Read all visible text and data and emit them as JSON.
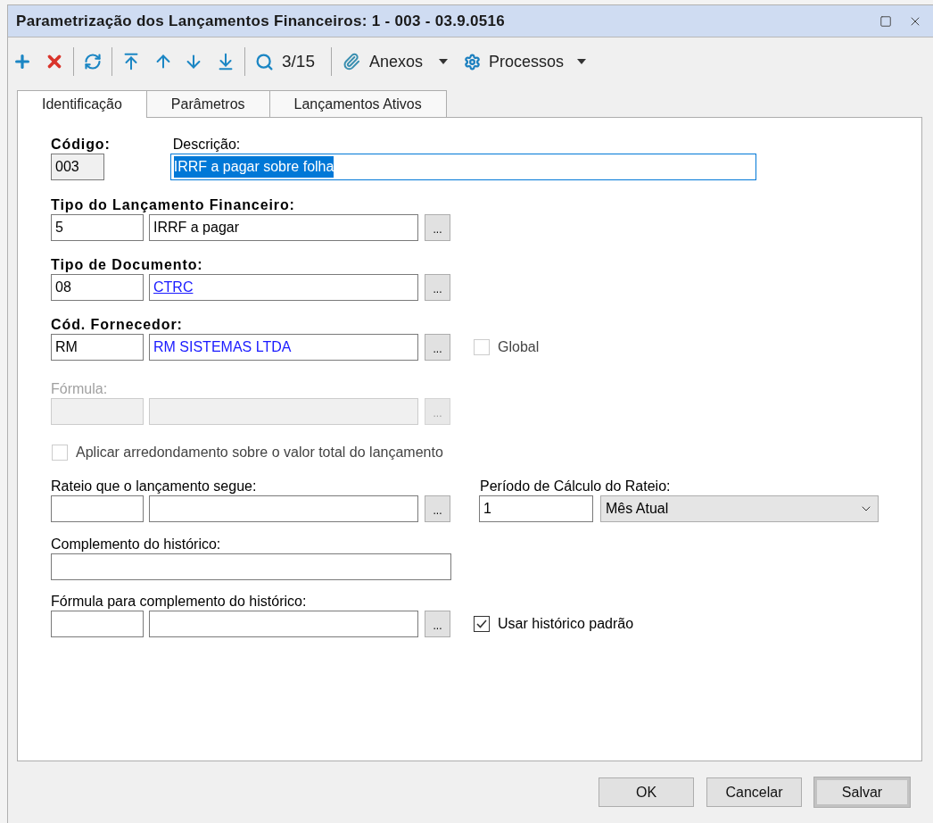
{
  "window": {
    "title": "Parametrização dos Lançamentos Financeiros: 1 - 003 - 03.9.0516"
  },
  "toolbar": {
    "record_counter": "3/15",
    "attachments_menu": {
      "label": "Anexos"
    },
    "processes_menu": {
      "label": "Processos"
    }
  },
  "tabs": [
    {
      "label": "Identificação",
      "selected": true
    },
    {
      "label": "Parâmetros",
      "selected": false
    },
    {
      "label": "Lançamentos Ativos",
      "selected": false
    }
  ],
  "form": {
    "code": {
      "label": "Código:",
      "required": true,
      "value": "003",
      "readonly": true
    },
    "description": {
      "label": "Descrição:",
      "required": false,
      "value": "IRRF a pagar sobre folha",
      "focused": true
    },
    "launch_type": {
      "label": "Tipo do Lançamento Financeiro:",
      "required": true,
      "code": "5",
      "description": {
        "value": "IRRF a pagar",
        "kind": "plain"
      },
      "button": "...",
      "disabled": false
    },
    "document_type": {
      "label": "Tipo de Documento:",
      "required": true,
      "code": "08",
      "description": {
        "value": "CTRC",
        "kind": "link"
      },
      "button": "...",
      "disabled": false
    },
    "supplier": {
      "label": "Cód. Fornecedor:",
      "required": true,
      "code": "RM",
      "description": {
        "value": "RM SISTEMAS LTDA",
        "kind": "emphasis"
      },
      "button": "...",
      "disabled": false,
      "option": {
        "label": "Global",
        "checked": false,
        "disabled": true
      }
    },
    "formula": {
      "label": "Fórmula:",
      "required": false,
      "button": "...",
      "disabled": true
    },
    "rounding_option": {
      "label": "Aplicar arredondamento sobre o valor total do lançamento",
      "checked": false,
      "disabled": true
    },
    "apportionment": {
      "label": "Rateio que o lançamento segue:",
      "required": false,
      "button": "...",
      "disabled": false
    },
    "period": {
      "label": "Período de Cálculo do Rateio:",
      "value": "1",
      "option": "Mês Atual"
    },
    "history_complement": {
      "label": "Complemento do histórico:"
    },
    "complement_formula": {
      "label": "Fórmula para complemento do histórico:",
      "required": false,
      "button": "...",
      "disabled": false,
      "option": {
        "label": "Usar histórico padrão",
        "checked": true,
        "disabled": false
      }
    }
  },
  "buttons": [
    {
      "label": "OK",
      "default": false
    },
    {
      "label": "Cancelar",
      "default": false
    },
    {
      "label": "Salvar",
      "default": true
    }
  ]
}
